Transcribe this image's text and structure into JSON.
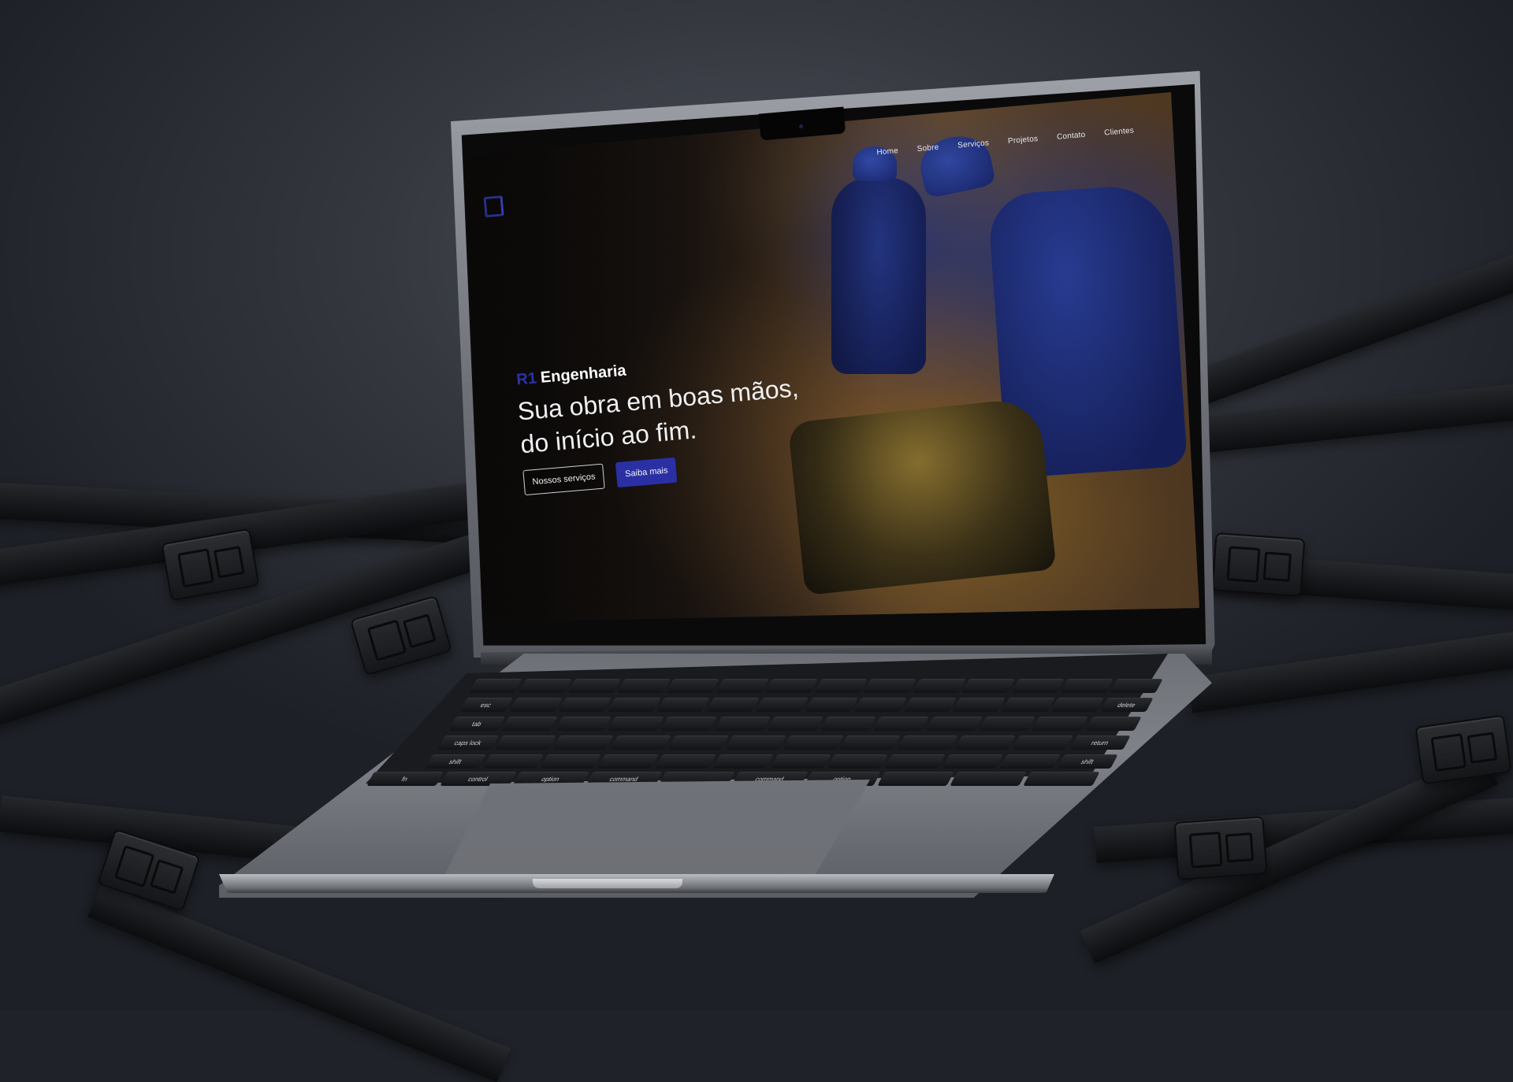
{
  "site": {
    "nav": [
      "Home",
      "Sobre",
      "Serviços",
      "Projetos",
      "Contato",
      "Clientes"
    ],
    "brand_prefix": "R1",
    "brand_name": "Engenharia",
    "headline_line1": "Sua obra em boas mãos,",
    "headline_line2": "do início ao fim.",
    "button_primary": "Nossos serviços",
    "button_secondary": "Saiba mais"
  },
  "keyboard": {
    "labels": [
      "esc",
      "tab",
      "caps lock",
      "shift",
      "fn",
      "control",
      "option",
      "command",
      "command",
      "option",
      "delete",
      "return",
      "shift"
    ]
  },
  "colors": {
    "accent": "#2a30a4",
    "background": "#2c2f36"
  },
  "icons": [
    "logo-mark-icon",
    "camera-icon"
  ]
}
